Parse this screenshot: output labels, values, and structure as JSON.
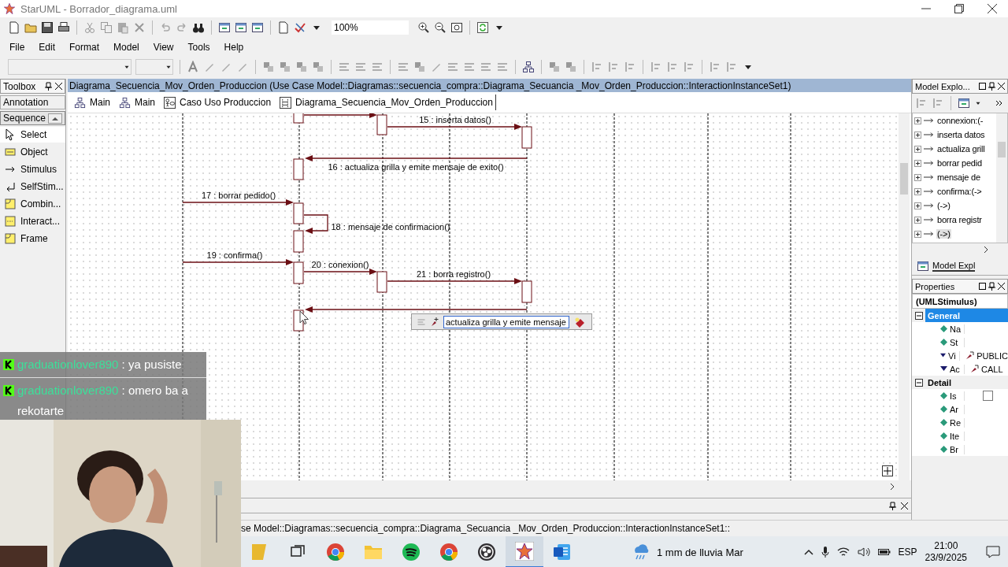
{
  "window": {
    "title": "StarUML - Borrador_diagrama.uml"
  },
  "zoom": {
    "value": "100%"
  },
  "menu": [
    "File",
    "Edit",
    "Format",
    "Model",
    "View",
    "Tools",
    "Help"
  ],
  "toolbox": {
    "title": "Toolbox",
    "groups": [
      {
        "label": "Annotation",
        "selected": false
      },
      {
        "label": "Sequence",
        "selected": true
      }
    ],
    "items": [
      {
        "label": "Select",
        "kind": "pointer",
        "selected": true
      },
      {
        "label": "Object",
        "kind": "object",
        "selected": false
      },
      {
        "label": "Stimulus",
        "kind": "arrow",
        "selected": false
      },
      {
        "label": "SelfStim...",
        "kind": "self",
        "selected": false
      },
      {
        "label": "Combin...",
        "kind": "frame",
        "selected": false
      },
      {
        "label": "Interact...",
        "kind": "dashed",
        "selected": false
      },
      {
        "label": "Frame",
        "kind": "frame",
        "selected": false
      }
    ]
  },
  "diagram": {
    "title": "Diagrama_Secuencia_Mov_Orden_Produccion (Use Case Model::Diagramas::secuencia_compra::Diagrama_Secuancia _Mov_Orden_Produccion::InteractionInstanceSet1)",
    "tabs": [
      {
        "label": "Main",
        "kind": "class",
        "selected": false
      },
      {
        "label": "Main",
        "kind": "class",
        "selected": false
      },
      {
        "label": "Caso Uso Produccion",
        "kind": "usecase",
        "selected": false
      },
      {
        "label": "Diagrama_Secuencia_Mov_Orden_Produccion",
        "kind": "sequence",
        "selected": true
      }
    ],
    "messages": [
      {
        "kind": "call"
      },
      {
        "kind": "call",
        "label": "15 : inserta datos()"
      },
      {
        "kind": "call",
        "label": "16 : actualiza grilla y emite mensaje de exito()"
      },
      {
        "kind": "call",
        "label": "17 : borrar pedido()"
      },
      {
        "kind": "self",
        "label": "18 : mensaje de confirmacion()"
      },
      {
        "kind": "call",
        "label": "19 : confirma()"
      },
      {
        "kind": "call",
        "label": "20 : conexion()"
      },
      {
        "kind": "call",
        "label": "21 : borra registro()"
      },
      {
        "kind": "call"
      }
    ],
    "editor": {
      "value": "actualiza grilla y emite mensaje"
    }
  },
  "model_explorer": {
    "title": "Model Explo...",
    "tab": "Model Expl",
    "items": [
      {
        "label": "connexion:(-",
        "selected": false
      },
      {
        "label": "inserta datos",
        "selected": false
      },
      {
        "label": "actualiza grill",
        "selected": false
      },
      {
        "label": "borrar pedid",
        "selected": false
      },
      {
        "label": "mensaje de",
        "selected": false
      },
      {
        "label": "confirma:(->",
        "selected": false
      },
      {
        "label": "(->)",
        "selected": false
      },
      {
        "label": "borra registr",
        "selected": false
      },
      {
        "label": "(->)",
        "selected": true
      }
    ]
  },
  "properties": {
    "title": "Properties",
    "type": "(UMLStimulus)",
    "groups": [
      {
        "label": "General",
        "selected": true,
        "rows": [
          {
            "name": "Na",
            "kind": "attribute"
          },
          {
            "name": "St",
            "kind": "attribute"
          },
          {
            "name": "Vi",
            "kind": "enum",
            "value": "PUBLIC"
          },
          {
            "name": "Ac",
            "kind": "enum",
            "value": "CALL"
          }
        ]
      },
      {
        "label": "Detail",
        "selected": false,
        "rows": [
          {
            "name": "Is",
            "kind": "attribute",
            "checked": false
          },
          {
            "name": "Ar",
            "kind": "attribute"
          },
          {
            "name": "Re",
            "kind": "attribute"
          },
          {
            "name": "Ite",
            "kind": "attribute"
          },
          {
            "name": "Br",
            "kind": "attribute"
          }
        ]
      }
    ]
  },
  "status_bar": {
    "text": "se Model::Diagramas::secuencia_compra::Diagrama_Secuancia _Mov_Orden_Produccion::InteractionInstanceSet1::"
  },
  "chat": [
    {
      "user": "graduationlover890",
      "text": ": ya pusiste"
    },
    {
      "user": "graduationlover890",
      "text": ": omero ba a rekotarte"
    }
  ],
  "taskbar": {
    "apps": [
      {
        "kind": "partial",
        "selected": false
      },
      {
        "kind": "taskview",
        "selected": false
      },
      {
        "kind": "browser",
        "selected": false
      },
      {
        "kind": "folder",
        "selected": false
      },
      {
        "kind": "music",
        "selected": false
      },
      {
        "kind": "browser",
        "selected": false
      },
      {
        "kind": "record",
        "selected": false
      },
      {
        "kind": "star",
        "selected": true
      },
      {
        "kind": "document",
        "selected": false
      }
    ],
    "weather": "1 mm de lluvia Mar",
    "language": "ESP",
    "time": "21:00",
    "date": "23/9/2025"
  }
}
